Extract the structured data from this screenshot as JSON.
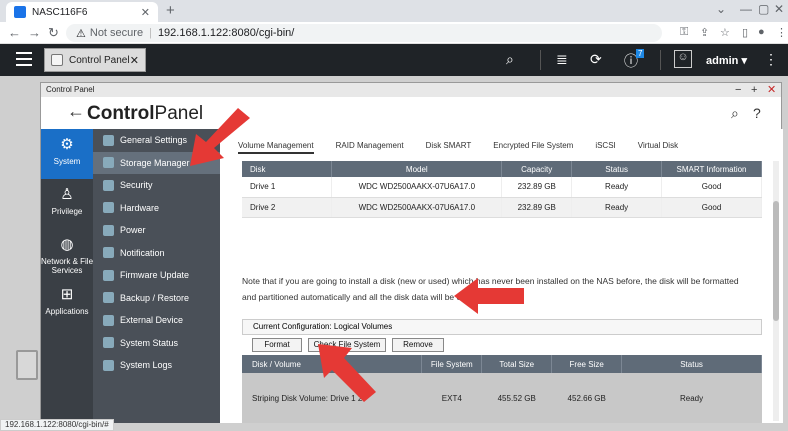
{
  "browser": {
    "tab_title": "NASC116F6",
    "url_security": "Not secure",
    "url": "192.168.1.122:8080/cgi-bin/",
    "status_url": "192.168.1.122:8080/cgi-bin/#"
  },
  "qnap": {
    "open_app": "Control Panel",
    "user": "admin",
    "notification_count": "7"
  },
  "window": {
    "title": "Control Panel",
    "heading_left": "Control",
    "heading_right": "Panel"
  },
  "sidebar": [
    {
      "label": "System",
      "icon": "gear-icon"
    },
    {
      "label": "Privilege",
      "icon": "user-icon"
    },
    {
      "label": "Network & File Services",
      "icon": "globe-icon"
    },
    {
      "label": "Applications",
      "icon": "apps-icon"
    }
  ],
  "submenu": [
    "General Settings",
    "Storage Manager",
    "Security",
    "Hardware",
    "Power",
    "Notification",
    "Firmware Update",
    "Backup / Restore",
    "External Device",
    "System Status",
    "System Logs"
  ],
  "tabs": [
    "Volume Management",
    "RAID Management",
    "Disk SMART",
    "Encrypted File System",
    "iSCSI",
    "Virtual Disk"
  ],
  "disk_table": {
    "headers": [
      "Disk",
      "Model",
      "Capacity",
      "Status",
      "SMART Information"
    ],
    "rows": [
      [
        "Drive 1",
        "WDC WD2500AAKX-07U6A17.0",
        "232.89 GB",
        "Ready",
        "Good"
      ],
      [
        "Drive 2",
        "WDC WD2500AAKX-07U6A17.0",
        "232.89 GB",
        "Ready",
        "Good"
      ]
    ]
  },
  "note": "Note that if you are going to install a disk (new or used) which has never been installed on the NAS before, the disk will be formatted and partitioned automatically and all the disk data will be cleared.",
  "config_label": "Current Configuration: Logical Volumes",
  "buttons": {
    "format": "Format",
    "check": "Check File System",
    "remove": "Remove"
  },
  "volume_table": {
    "headers": [
      "Disk / Volume",
      "File System",
      "Total Size",
      "Free Size",
      "Status"
    ],
    "row": [
      "Striping Disk Volume: Drive 1 2",
      "EXT4",
      "455.52 GB",
      "452.66 GB",
      "Ready"
    ]
  },
  "colors": {
    "accent": "#1a6fc7",
    "arrow": "#e53935",
    "good": "#2e7d32"
  }
}
